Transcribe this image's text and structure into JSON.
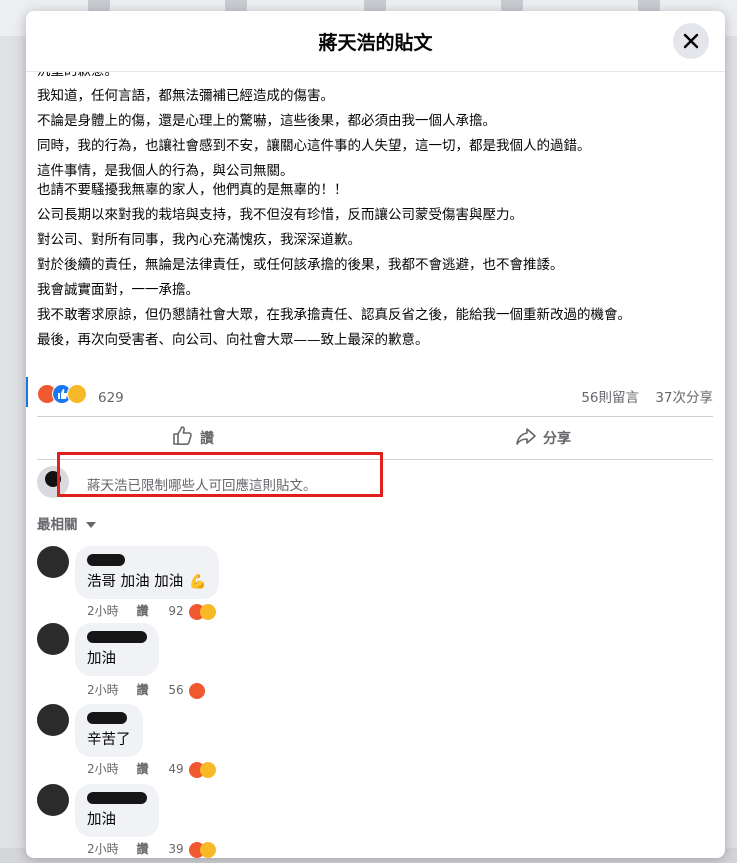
{
  "modal": {
    "title": "蔣天浩的貼文",
    "close_icon": "close-icon"
  },
  "post": {
    "lines": [
      "沉重的歉意。",
      "我知道，任何言語，都無法彌補已經造成的傷害。",
      "不論是身體上的傷，還是心理上的驚嚇，這些後果，都必須由我一個人承擔。",
      "同時，我的行為，也讓社會感到不安，讓關心這件事的人失望，這一切，都是我個人的過錯。",
      "這件事情，是我個人的行為，與公司無關。",
      "也請不要騷擾我無辜的家人，他們真的是無辜的！！",
      "公司長期以來對我的栽培與支持，我不但沒有珍惜，反而讓公司蒙受傷害與壓力。",
      "對公司、對所有同事，我內心充滿愧疚，我深深道歉。",
      "對於後續的責任，無論是法律責任，或任何該承擔的後果，我都不會逃避，也不會推諉。",
      "我會誠實面對，一一承擔。",
      "我不敢奢求原諒，但仍懇請社會大眾，在我承擔責任、認真反省之後，能給我一個重新改過的機會。",
      "最後，再次向受害者、向公司、向社會大眾——致上最深的歉意。"
    ],
    "reaction_count": "629",
    "comments_count": "56則留言",
    "shares_count": "37次分享",
    "reactions": [
      "angry-reaction-icon",
      "like-reaction-icon",
      "haha-reaction-icon"
    ]
  },
  "actions": {
    "like_label": "讚",
    "share_label": "分享"
  },
  "restriction": {
    "text": "蔣天浩已限制哪些人可回應這則貼文。"
  },
  "sort": {
    "label": "最相關"
  },
  "comments": [
    {
      "text": "浩哥 加油 加油",
      "time": "2小時",
      "like": "讚",
      "likes": "92",
      "emoji": "flexed-biceps-icon"
    },
    {
      "text": "加油",
      "time": "2小時",
      "like": "讚",
      "likes": "56"
    },
    {
      "text": "辛苦了",
      "time": "2小時",
      "like": "讚",
      "likes": "49"
    },
    {
      "text": "加油",
      "time": "2小時",
      "like": "讚",
      "likes": "39"
    }
  ],
  "colors": {
    "highlight_box": "#e0201a",
    "link_blue": "#1877f2",
    "secondary_text": "#65676b"
  }
}
